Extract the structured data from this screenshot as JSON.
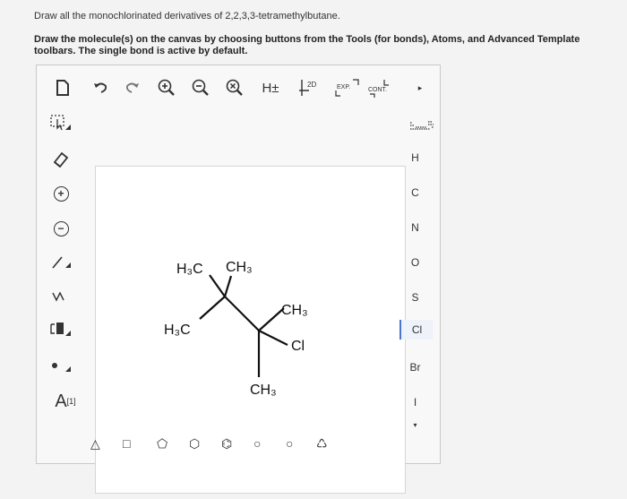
{
  "question": {
    "line1": "Draw all the monochlorinated derivatives of 2,2,3,3-tetramethylbutane.",
    "line2": "Draw the molecule(s) on the canvas by choosing buttons from the Tools (for bonds), Atoms, and Advanced Template toolbars. The single bond is active by default."
  },
  "toolbar": {
    "hydrogen_label": "H±",
    "label_2d": "2D",
    "expand_label": "EXP.",
    "contract_label": "CONT.",
    "more_icon": "▸"
  },
  "left_tools": {
    "charge_label": "A",
    "charge_superscript": "[1]"
  },
  "atoms": [
    "H",
    "C",
    "N",
    "O",
    "S",
    "Cl",
    "Br",
    "I"
  ],
  "selected_atom": "Cl",
  "molecule": {
    "label_h3c_top": "H₃C",
    "label_ch3_top": "CH₃",
    "label_ch3_right": "CH₃",
    "label_h3c_left": "H₃C",
    "label_cl": "Cl",
    "label_ch3_bottom": "CH₃"
  },
  "colors": {
    "accent": "#4a74c9",
    "canvas": "#ffffff"
  }
}
